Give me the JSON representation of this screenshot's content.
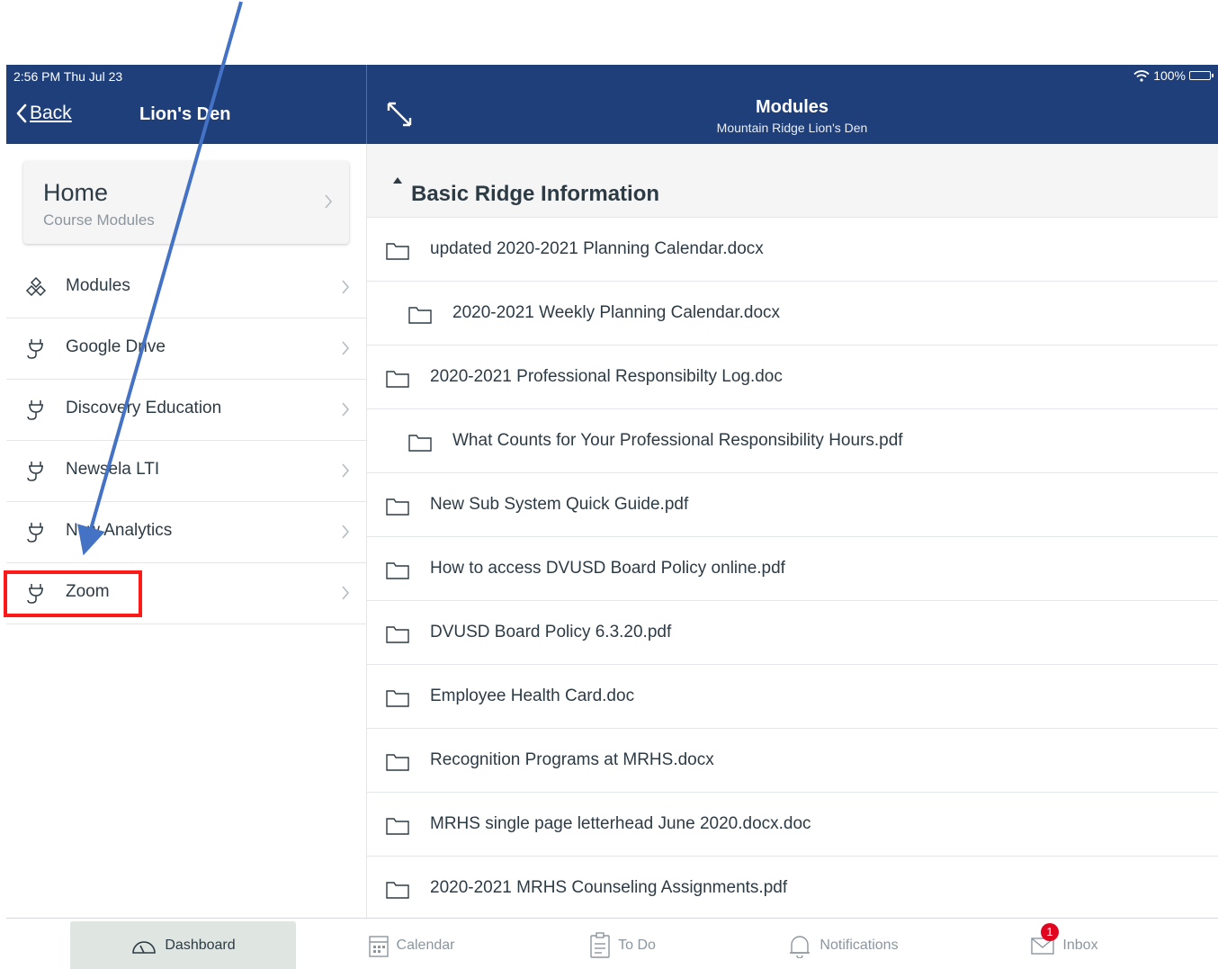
{
  "status_bar": {
    "time": "2:56 PM   Thu Jul 23",
    "battery": "100%"
  },
  "header": {
    "back_label": "Back",
    "left_title": "Lion's Den",
    "title": "Modules",
    "subtitle": "Mountain Ridge Lion's Den"
  },
  "home_card": {
    "title": "Home",
    "subtitle": "Course Modules"
  },
  "nav": {
    "items": [
      {
        "label": "Modules",
        "icon": "modules-icon"
      },
      {
        "label": "Google Drive",
        "icon": "plug-icon"
      },
      {
        "label": "Discovery Education",
        "icon": "plug-icon"
      },
      {
        "label": "Newsela LTI",
        "icon": "plug-icon"
      },
      {
        "label": "New Analytics",
        "icon": "plug-icon"
      },
      {
        "label": "Zoom",
        "icon": "plug-icon",
        "highlighted": true
      }
    ]
  },
  "module_section": {
    "title": "Basic Ridge Information",
    "items": [
      {
        "label": "updated 2020-2021 Planning Calendar.docx",
        "indent": 0
      },
      {
        "label": "2020-2021 Weekly Planning Calendar.docx",
        "indent": 1
      },
      {
        "label": "2020-2021 Professional Responsibilty Log.doc",
        "indent": 0
      },
      {
        "label": "What Counts for Your Professional Responsibility Hours.pdf",
        "indent": 1
      },
      {
        "label": "New Sub System Quick Guide.pdf",
        "indent": 0
      },
      {
        "label": "How to access DVUSD Board Policy online.pdf",
        "indent": 0
      },
      {
        "label": "DVUSD Board Policy 6.3.20.pdf",
        "indent": 0
      },
      {
        "label": "Employee Health Card.doc",
        "indent": 0
      },
      {
        "label": "Recognition Programs at MRHS.docx",
        "indent": 0
      },
      {
        "label": "MRHS single page letterhead June 2020.docx.doc",
        "indent": 0
      },
      {
        "label": "2020-2021 MRHS Counseling Assignments.pdf",
        "indent": 0
      }
    ]
  },
  "tabbar": {
    "dashboard": "Dashboard",
    "calendar": "Calendar",
    "todo": "To Do",
    "notifications": "Notifications",
    "inbox": "Inbox",
    "inbox_badge": "1"
  },
  "colors": {
    "header_bg": "#1f3f7a",
    "highlight": "#ff1a1a",
    "arrow": "#4472c4",
    "badge": "#e0061f"
  }
}
